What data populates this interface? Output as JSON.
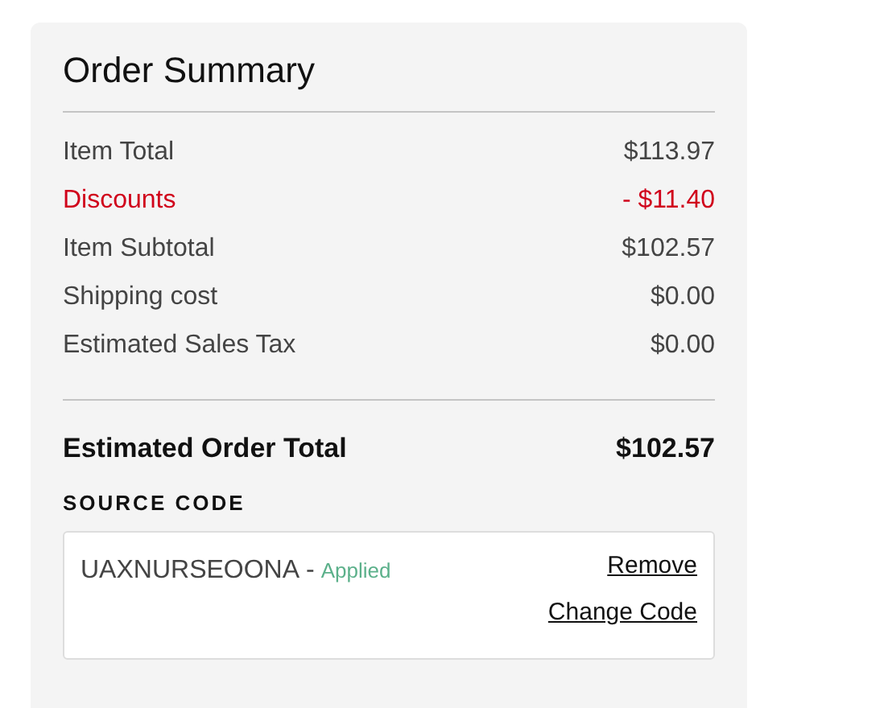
{
  "title": "Order Summary",
  "lines": [
    {
      "label": "Item Total",
      "value": "$113.97",
      "kind": "normal"
    },
    {
      "label": "Discounts",
      "value": "- $11.40",
      "kind": "discount"
    },
    {
      "label": "Item Subtotal",
      "value": "$102.57",
      "kind": "normal"
    },
    {
      "label": "Shipping cost",
      "value": "$0.00",
      "kind": "normal"
    },
    {
      "label": "Estimated Sales Tax",
      "value": "$0.00",
      "kind": "normal"
    }
  ],
  "total": {
    "label": "Estimated Order Total",
    "value": "$102.57"
  },
  "source_code": {
    "heading": "SOURCE CODE",
    "code": "UAXNURSEOONA",
    "separator": "-",
    "status": "Applied",
    "links": [
      "Remove",
      "Change Code"
    ]
  }
}
